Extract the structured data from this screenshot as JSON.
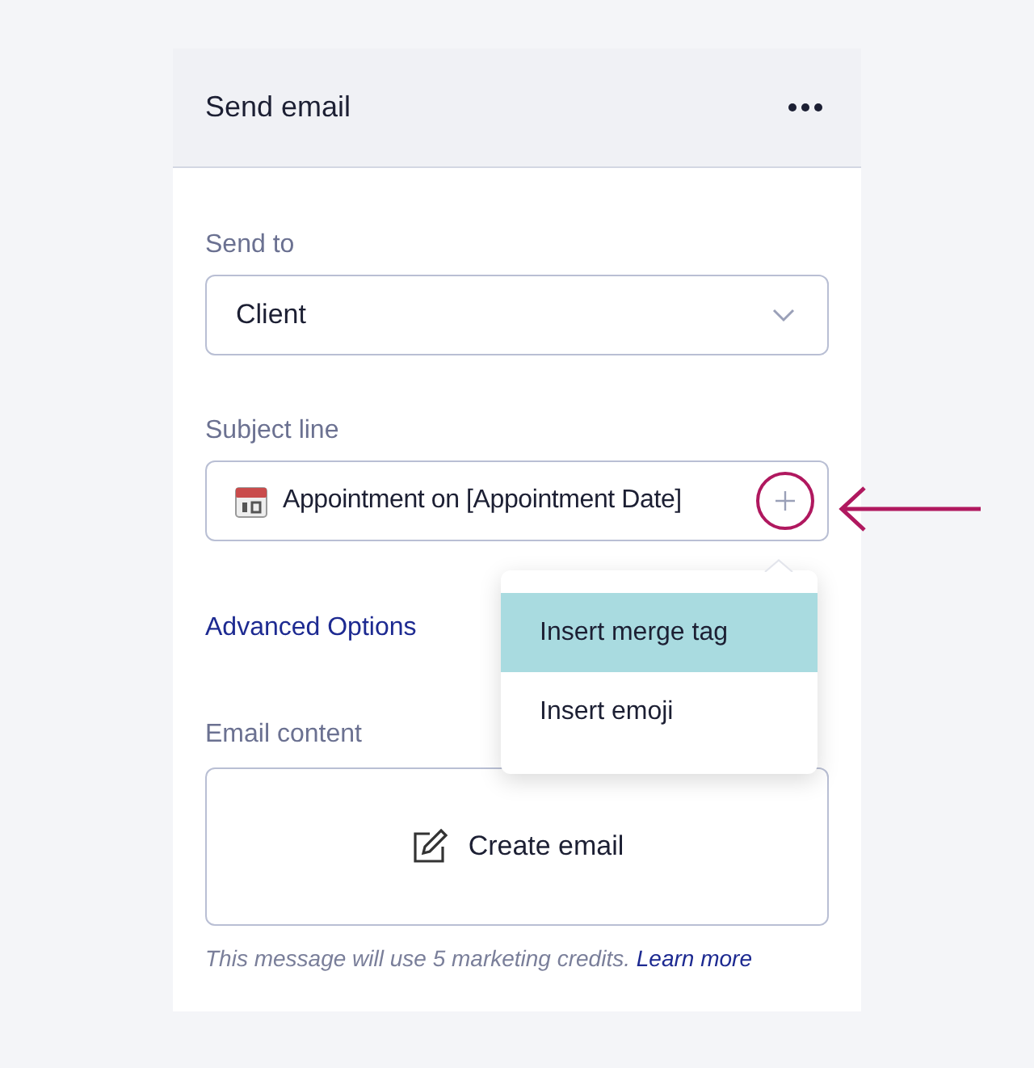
{
  "panel": {
    "title": "Send email"
  },
  "send_to": {
    "label": "Send to",
    "value": "Client"
  },
  "subject": {
    "label": "Subject line",
    "value": "Appointment on [Appointment Date]"
  },
  "insert_menu": {
    "expanded": true,
    "items": [
      {
        "label": "Insert merge tag",
        "selected": true
      },
      {
        "label": "Insert emoji",
        "selected": false
      }
    ]
  },
  "advanced_link": "Advanced Options",
  "email_content": {
    "label": "Email content",
    "button": "Create email"
  },
  "footer": {
    "note": "This message will use 5 marketing credits.",
    "link": "Learn more"
  }
}
